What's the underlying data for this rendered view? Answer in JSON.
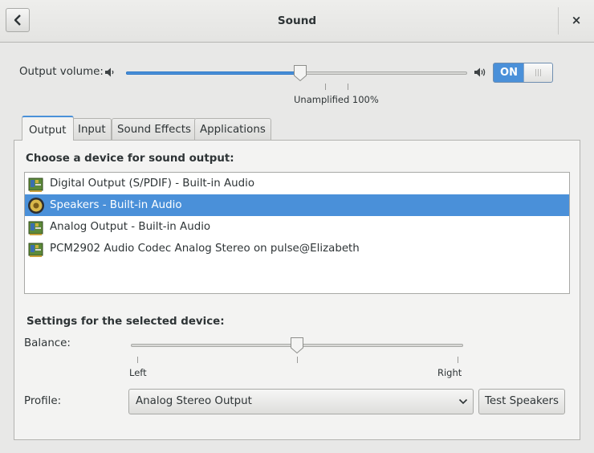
{
  "window": {
    "title": "Sound",
    "close_glyph": "×"
  },
  "header": {
    "back_icon": "chevron-left-icon"
  },
  "output_volume": {
    "label": "Output volume:",
    "level_fraction": 0.51,
    "mark_text": "Unamplified 100%",
    "switch_label": "ON",
    "switch_state": true
  },
  "tabs": [
    {
      "label": "Output",
      "active": true
    },
    {
      "label": "Input"
    },
    {
      "label": "Sound Effects"
    },
    {
      "label": "Applications"
    }
  ],
  "output": {
    "choose_title": "Choose a device for sound output:",
    "devices": [
      {
        "label": "Digital Output (S/PDIF) - Built-in Audio",
        "icon": "audio-card-icon",
        "selected": false
      },
      {
        "label": "Speakers - Built-in Audio",
        "icon": "speaker-icon",
        "selected": true
      },
      {
        "label": "Analog Output - Built-in Audio",
        "icon": "audio-card-icon",
        "selected": false
      },
      {
        "label": "PCM2902 Audio Codec Analog Stereo on pulse@Elizabeth",
        "icon": "audio-card-icon",
        "selected": false
      }
    ],
    "settings_title": "Settings for the selected device:",
    "balance": {
      "label": "Balance:",
      "left_label": "Left",
      "right_label": "Right",
      "value_fraction": 0.5
    },
    "profile": {
      "label": "Profile:",
      "value": "Analog Stereo Output"
    },
    "test_button": "Test Speakers"
  },
  "colors": {
    "accent": "#4a90d9",
    "selected_text": "#ffffff"
  }
}
